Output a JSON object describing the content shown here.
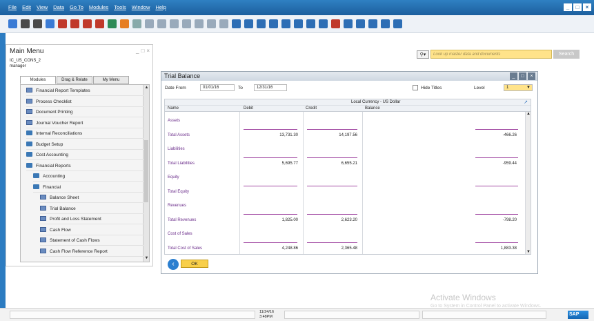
{
  "menubar": {
    "items": [
      "File",
      "Edit",
      "View",
      "Data",
      "Go To",
      "Modules",
      "Tools",
      "Window",
      "Help"
    ]
  },
  "main_menu": {
    "title": "Main Menu",
    "company_db": "IC_US_CONS_2",
    "user": "manager",
    "tabs": [
      "Modules",
      "Drag & Relate",
      "My Menu"
    ],
    "items": [
      {
        "label": "Financial Report Templates",
        "indent": 0,
        "icon": "document-icon"
      },
      {
        "label": "Process Checklist",
        "indent": 0,
        "icon": "document-icon"
      },
      {
        "label": "Document Printing",
        "indent": 0,
        "icon": "document-icon"
      },
      {
        "label": "Journal Voucher Report",
        "indent": 0,
        "icon": "document-icon"
      },
      {
        "label": "Internal Reconciliations",
        "indent": 0,
        "icon": "folder-icon"
      },
      {
        "label": "Budget Setup",
        "indent": 0,
        "icon": "folder-icon"
      },
      {
        "label": "Cost Accounting",
        "indent": 0,
        "icon": "folder-icon"
      },
      {
        "label": "Financial Reports",
        "indent": 0,
        "icon": "folder-open-icon"
      },
      {
        "label": "Accounting",
        "indent": 1,
        "icon": "folder-icon"
      },
      {
        "label": "Financial",
        "indent": 1,
        "icon": "folder-open-icon"
      },
      {
        "label": "Balance Sheet",
        "indent": 2,
        "icon": "report-icon"
      },
      {
        "label": "Trial Balance",
        "indent": 2,
        "icon": "report-icon"
      },
      {
        "label": "Profit and Loss Statement",
        "indent": 2,
        "icon": "report-icon"
      },
      {
        "label": "Cash Flow",
        "indent": 2,
        "icon": "report-icon"
      },
      {
        "label": "Statement of Cash Flows",
        "indent": 2,
        "icon": "report-icon"
      },
      {
        "label": "Cash Flow Reference Report",
        "indent": 2,
        "icon": "report-icon"
      }
    ]
  },
  "search": {
    "placeholder": "Look up master data and documents",
    "button": "Search"
  },
  "trial_balance": {
    "title": "Trial Balance",
    "date_from_label": "Date From",
    "date_from": "01/01/16",
    "to_label": "To",
    "date_to": "12/31/16",
    "hide_titles_label": "Hide Titles",
    "level_label": "Level",
    "level_value": "1",
    "currency_header": "Local Currency - US Dollar",
    "columns": [
      "Name",
      "Debit",
      "Credit",
      "Balance"
    ],
    "rows": [
      {
        "name": "Assets",
        "debit": "",
        "credit": "",
        "balance": ""
      },
      {
        "name": "Total Assets",
        "debit": "13,731.30",
        "credit": "14,197.56",
        "balance": "-466.26"
      },
      {
        "name": "Liabilities",
        "debit": "",
        "credit": "",
        "balance": ""
      },
      {
        "name": "Total Liabilities",
        "debit": "5,695.77",
        "credit": "6,655.21",
        "balance": "-959.44"
      },
      {
        "name": "Equity",
        "debit": "",
        "credit": "",
        "balance": ""
      },
      {
        "name": "Total Equity",
        "debit": "",
        "credit": "",
        "balance": ""
      },
      {
        "name": "Revenues",
        "debit": "",
        "credit": "",
        "balance": ""
      },
      {
        "name": "Total Revenues",
        "debit": "1,825.00",
        "credit": "2,623.20",
        "balance": "-798.20"
      },
      {
        "name": "Cost of Sales",
        "debit": "",
        "credit": "",
        "balance": ""
      },
      {
        "name": "Total Cost of Sales",
        "debit": "4,248.86",
        "credit": "2,365.48",
        "balance": "1,883.38"
      }
    ],
    "ok_label": "OK"
  },
  "watermark": {
    "line1": "Activate Windows",
    "line2": "Go to System in Control Panel to activate Windows."
  },
  "status": {
    "date": "11/24/16",
    "time": "3:48PM",
    "brand": "SAP"
  }
}
